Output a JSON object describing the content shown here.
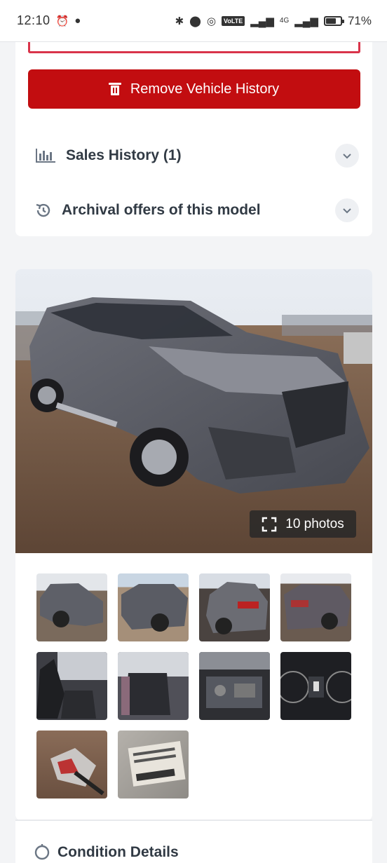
{
  "status_bar": {
    "time": "12:10",
    "network": "4G",
    "volte": "VoLTE",
    "battery_percent_label": "71%",
    "battery_level": 0.71
  },
  "actions": {
    "remove_history_label": "Remove Vehicle History"
  },
  "accordions": {
    "sales_history_label": "Sales History (1)",
    "archival_offers_label": "Archival offers of this model"
  },
  "gallery": {
    "photos_count_label": "10 photos",
    "thumbnails": [
      "front-left damaged view",
      "front-left side view",
      "rear-left view",
      "rear-right view",
      "front seats interior",
      "rear seats interior",
      "engine bay",
      "instrument cluster",
      "damaged part close-up",
      "vin sticker"
    ]
  },
  "condition": {
    "title": "Condition Details"
  },
  "colors": {
    "accent_red": "#c20d10",
    "outline_red": "#d9344a",
    "text_dark": "#313a44"
  }
}
